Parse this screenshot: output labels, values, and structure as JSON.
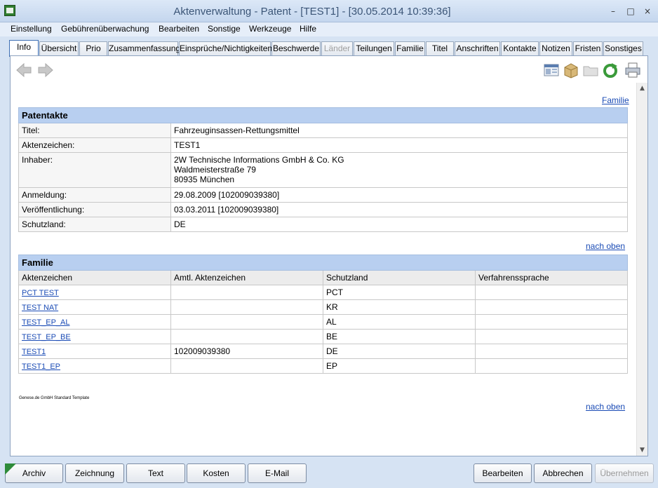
{
  "window": {
    "title": "Aktenverwaltung - Patent - [TEST1] - [30.05.2014 10:39:36]",
    "minimize": "–",
    "maximize": "□",
    "close": "×"
  },
  "menu": [
    "Einstellung",
    "Gebührenüberwachung",
    "Bearbeiten",
    "Sonstige",
    "Werkzeuge",
    "Hilfe"
  ],
  "tabs": [
    {
      "label": "Info",
      "active": true
    },
    {
      "label": "Übersicht"
    },
    {
      "label": "Prio"
    },
    {
      "label": "Zusammenfassung"
    },
    {
      "label": "Einsprüche/Nichtigkeiten"
    },
    {
      "label": "Beschwerde"
    },
    {
      "label": "Länder",
      "disabled": true
    },
    {
      "label": "Teilungen"
    },
    {
      "label": "Familie"
    },
    {
      "label": "Titel"
    },
    {
      "label": "Anschriften"
    },
    {
      "label": "Kontakte"
    },
    {
      "label": "Notizen"
    },
    {
      "label": "Fristen"
    },
    {
      "label": "Sonstiges"
    }
  ],
  "toolbar": {
    "icons": [
      "back-arrow-icon",
      "forward-arrow-icon",
      "layout-icon",
      "archive-box-icon",
      "folder-icon",
      "refresh-icon",
      "print-icon"
    ]
  },
  "links": {
    "familie": "Familie",
    "nach_oben_1": "nach oben",
    "nach_oben_2": "nach oben"
  },
  "patentakte": {
    "heading": "Patentakte",
    "rows": [
      {
        "label": "Titel:",
        "value": "Fahrzeuginsassen-Rettungsmittel"
      },
      {
        "label": "Aktenzeichen:",
        "value": "TEST1"
      },
      {
        "label": "Inhaber:",
        "value": "2W Technische Informations GmbH & Co. KG",
        "value2": "Waldmeisterstraße 79",
        "value3": "80935  München"
      },
      {
        "label": "Anmeldung:",
        "value": "29.08.2009   [102009039380]"
      },
      {
        "label": "Veröffentlichung:",
        "value": "03.03.2011   [102009039380]"
      },
      {
        "label": "Schutzland:",
        "value": "DE"
      }
    ]
  },
  "familie": {
    "heading": "Familie",
    "columns": [
      "Aktenzeichen",
      "Amtl. Aktenzeichen",
      "Schutzland",
      "Verfahrenssprache"
    ],
    "rows": [
      {
        "az": "PCT TEST",
        "amtl": "",
        "land": "PCT",
        "sprache": ""
      },
      {
        "az": "TEST NAT",
        "amtl": "",
        "land": "KR",
        "sprache": ""
      },
      {
        "az": "TEST_EP_AL",
        "amtl": "",
        "land": "AL",
        "sprache": ""
      },
      {
        "az": "TEST_EP_BE",
        "amtl": "",
        "land": "BE",
        "sprache": ""
      },
      {
        "az": "TEST1",
        "amtl": "102009039380",
        "land": "DE",
        "sprache": ""
      },
      {
        "az": "TEST1_EP",
        "amtl": "",
        "land": "EP",
        "sprache": ""
      }
    ]
  },
  "footer_note": "Genese.de GmbH Standard Template",
  "buttons": {
    "archiv": "Archiv",
    "zeichnung": "Zeichnung",
    "text": "Text",
    "kosten": "Kosten",
    "email": "E-Mail",
    "bearbeiten": "Bearbeiten",
    "abbrechen": "Abbrechen",
    "uebernehmen": "Übernehmen"
  }
}
